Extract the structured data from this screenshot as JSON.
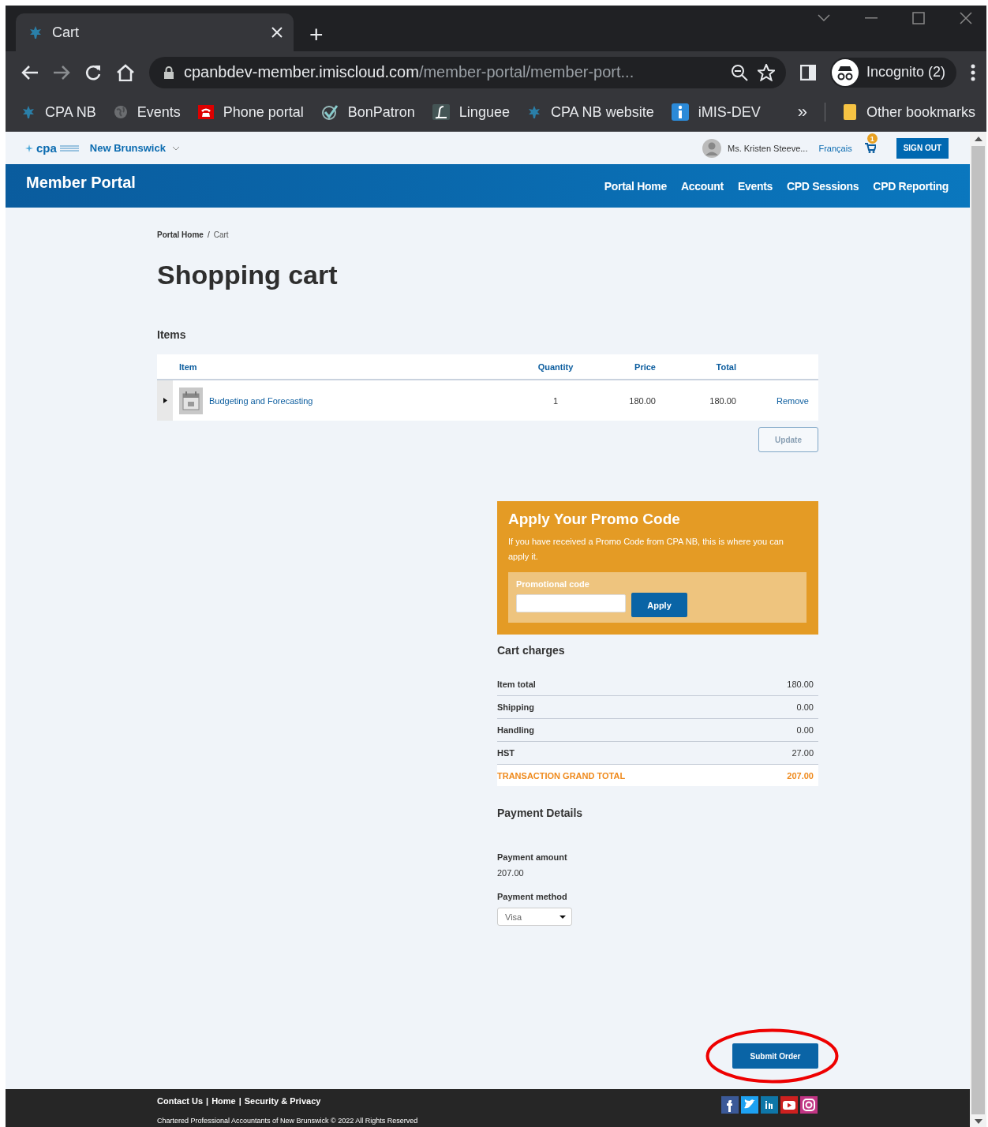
{
  "browser": {
    "tab_title": "Cart",
    "new_tab": "+",
    "url_host": "cpanbdev-member.imiscloud.com",
    "url_path": "/member-portal/member-port...",
    "profile": "Incognito (2)",
    "bookmarks": [
      {
        "label": "CPA NB",
        "kind": "leaf"
      },
      {
        "label": "Events",
        "kind": "globe"
      },
      {
        "label": "Phone portal",
        "kind": "phone"
      },
      {
        "label": "BonPatron",
        "kind": "check"
      },
      {
        "label": "Linguee",
        "kind": "linguee"
      },
      {
        "label": "CPA NB website",
        "kind": "leaf"
      },
      {
        "label": "iMIS-DEV",
        "kind": "info"
      }
    ],
    "more": "»",
    "other_bookmarks": "Other bookmarks"
  },
  "site": {
    "logo_text": "cpa",
    "region": "New Brunswick",
    "user": "Ms. Kristen Steeve...",
    "language": "Français",
    "cart_count": "1",
    "sign_out": "SIGN OUT",
    "portal_title": "Member Portal",
    "nav": [
      {
        "label": "Portal Home"
      },
      {
        "label": "Account"
      },
      {
        "label": "Events"
      },
      {
        "label": "CPD Sessions"
      },
      {
        "label": "CPD Reporting"
      }
    ]
  },
  "breadcrumb": {
    "items": [
      "Portal Home",
      "Cart"
    ],
    "separator": "/"
  },
  "title": "Shopping cart",
  "items": {
    "heading": "Items",
    "columns": [
      "Item",
      "Quantity",
      "Price",
      "Total"
    ],
    "rows": [
      {
        "item": "Budgeting and Forecasting",
        "quantity": "1",
        "price": "180.00",
        "total": "180.00",
        "action": "Remove"
      }
    ],
    "update_button": "Update"
  },
  "promo": {
    "title": "Apply Your Promo Code",
    "description": "If you have received a Promo Code from CPA NB, this is where you can apply it.",
    "field_label": "Promotional code",
    "button": "Apply"
  },
  "charges": {
    "heading": "Cart charges",
    "rows": [
      {
        "label": "Item total",
        "value": "180.00",
        "kind": "line"
      },
      {
        "label": "Shipping",
        "value": "0.00",
        "kind": "line"
      },
      {
        "label": "Handling",
        "value": "0.00",
        "kind": "line"
      },
      {
        "label": "HST",
        "value": "27.00",
        "kind": "line"
      },
      {
        "label": "TRANSACTION GRAND TOTAL",
        "value": "207.00",
        "kind": "grand"
      }
    ]
  },
  "payment": {
    "heading": "Payment Details",
    "amount_label": "Payment amount",
    "amount": "207.00",
    "method_label": "Payment method",
    "method": "Visa"
  },
  "submit": {
    "label": "Submit Order",
    "highlighted": true
  },
  "footer": {
    "links": [
      "Contact Us",
      "Home",
      "Security & Privacy"
    ],
    "separator": "|",
    "copyright": "Chartered Professional Accountants of New Brunswick © 2022 All Rights Reserved",
    "social": [
      {
        "kind": "facebook",
        "color": "#3b5998"
      },
      {
        "kind": "twitter",
        "color": "#1da1f2"
      },
      {
        "kind": "linkedin",
        "color": "#0e76a8"
      },
      {
        "kind": "youtube",
        "color": "#cd201f"
      },
      {
        "kind": "instagram",
        "color": "#c13584"
      }
    ]
  }
}
